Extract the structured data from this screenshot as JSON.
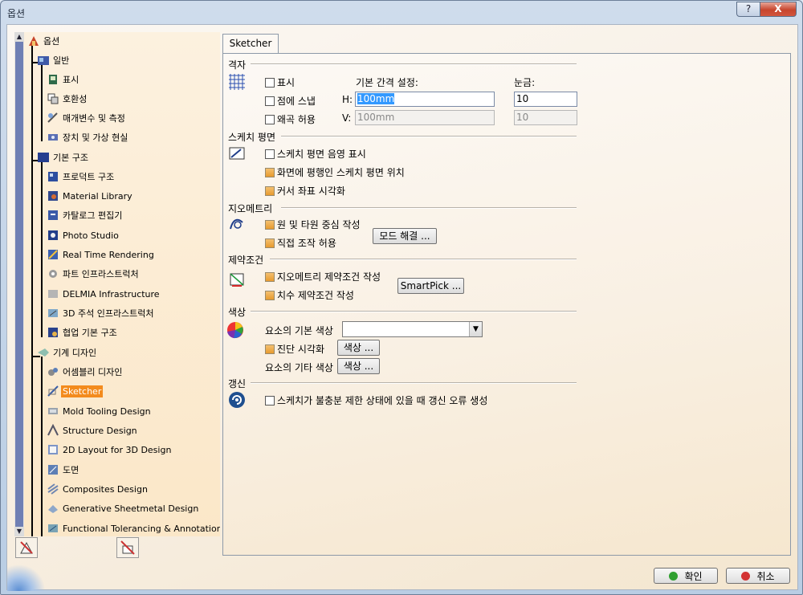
{
  "window": {
    "title": "옵션",
    "help_label": "?",
    "close_label": "X"
  },
  "tree": {
    "items": [
      {
        "label": "옵션"
      },
      {
        "label": "일반"
      },
      {
        "label": "표시"
      },
      {
        "label": "호환성"
      },
      {
        "label": "매개변수 및 측정"
      },
      {
        "label": "장치 및 가상 현실"
      },
      {
        "label": "기본 구조"
      },
      {
        "label": "프로덕트 구조"
      },
      {
        "label": "Material Library"
      },
      {
        "label": "카탈로그 편집기"
      },
      {
        "label": "Photo Studio"
      },
      {
        "label": "Real Time Rendering"
      },
      {
        "label": "파트 인프라스트럭처"
      },
      {
        "label": "DELMIA Infrastructure"
      },
      {
        "label": "3D 주석 인프라스트럭처"
      },
      {
        "label": "협업 기본 구조"
      },
      {
        "label": "기계 디자인"
      },
      {
        "label": "어셈블리 디자인"
      },
      {
        "label": "Sketcher"
      },
      {
        "label": "Mold Tooling Design"
      },
      {
        "label": "Structure Design"
      },
      {
        "label": "2D Layout for 3D Design"
      },
      {
        "label": "도면"
      },
      {
        "label": "Composites Design"
      },
      {
        "label": "Generative Sheetmetal Design"
      },
      {
        "label": "Functional Tolerancing & Annotation"
      }
    ],
    "selected": "Sketcher",
    "scroll_up_icon": "▲",
    "scroll_down_icon": "▼"
  },
  "tab": {
    "label": "Sketcher"
  },
  "grid": {
    "title": "격자",
    "display_label": "표시",
    "snap_label": "점에 스냅",
    "distortion_label": "왜곡 허용",
    "primary_spacing_label": "기본 간격 설정:",
    "graduations_label": "눈금:",
    "h_label": "H:",
    "v_label": "V:",
    "h_value": "100mm",
    "v_value": "100mm",
    "h_grad": "10",
    "v_grad": "10"
  },
  "sketch_plane": {
    "title": "스케치 평면",
    "shading_label": "스케치 평면 음영 표시",
    "parallel_label": "화면에 평행인 스케치 평면 위치",
    "cursor_label": "커서 좌표 시각화"
  },
  "geometry": {
    "title": "지오메트리",
    "centers_label": "원 및 타원 중심 작성",
    "direct_label": "직접 조작 허용",
    "solving_mode_button": "모드 해결 ..."
  },
  "constraints": {
    "title": "제약조건",
    "geometric_label": "지오메트리 제약조건 작성",
    "dimensional_label": "치수 제약조건 작성",
    "smartpick_button": "SmartPick ..."
  },
  "colors": {
    "title": "색상",
    "default_color_label": "요소의 기본 색상",
    "diagnosis_label": "진단 시각화",
    "other_color_label": "요소의 기타 색상",
    "color_button": "색상 ...",
    "color_button_2": "색상 ..."
  },
  "update": {
    "title": "갱신",
    "error_label": "스케치가 불충분 제한 상태에 있을 때 갱신 오류 생성"
  },
  "footer": {
    "ok_label": "확인",
    "cancel_label": "취소"
  },
  "accent_colors": {
    "selection": "#f38b1d",
    "ok_dot": "#2fa02f",
    "cancel_dot": "#d33333"
  }
}
